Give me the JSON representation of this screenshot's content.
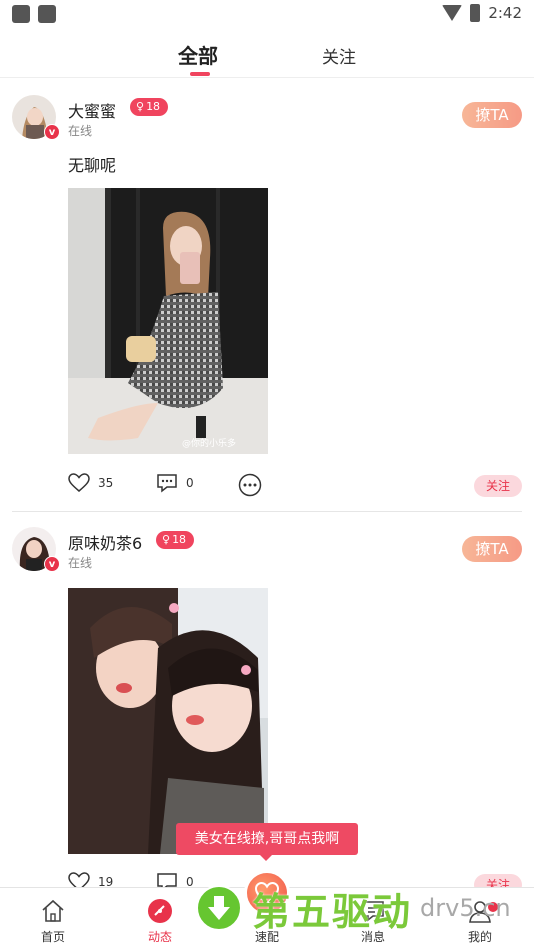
{
  "status_bar": {
    "time": "2:42"
  },
  "tabs": [
    {
      "label": "全部",
      "active": true
    },
    {
      "label": "关注",
      "active": false
    }
  ],
  "colors": {
    "accent": "#f0445e",
    "tease_gradient": [
      "#f7b697",
      "#f69a85"
    ],
    "follow_bg": "#fbd8dd"
  },
  "posts": [
    {
      "nickname": "大蜜蜜",
      "age": "18",
      "gender_icon": "female-icon",
      "status": "在线",
      "verified_badge": "v",
      "tease_label": "撩TA",
      "text": "无聊呢",
      "photo_watermark": "@你的小乐多",
      "likes": "35",
      "comments": "0",
      "follow_label": "关注"
    },
    {
      "nickname": "原味奶茶6",
      "age": "18",
      "gender_icon": "female-icon",
      "status": "在线",
      "verified_badge": "v",
      "tease_label": "撩TA",
      "text": "",
      "likes": "19",
      "comments": "0",
      "follow_label": "关注"
    }
  ],
  "tooltip": {
    "text": "美女在线撩,哥哥点我啊"
  },
  "bottom_nav": [
    {
      "label": "首页",
      "icon": "home-icon"
    },
    {
      "label": "动态",
      "icon": "dynamic-icon",
      "active": true
    },
    {
      "label": "速配",
      "icon": "match-icon"
    },
    {
      "label": "消息",
      "icon": "message-icon"
    },
    {
      "label": "我的",
      "icon": "profile-icon",
      "badge": true
    }
  ],
  "watermark": {
    "text": "第五驱动",
    "url": "drv5.cn"
  }
}
